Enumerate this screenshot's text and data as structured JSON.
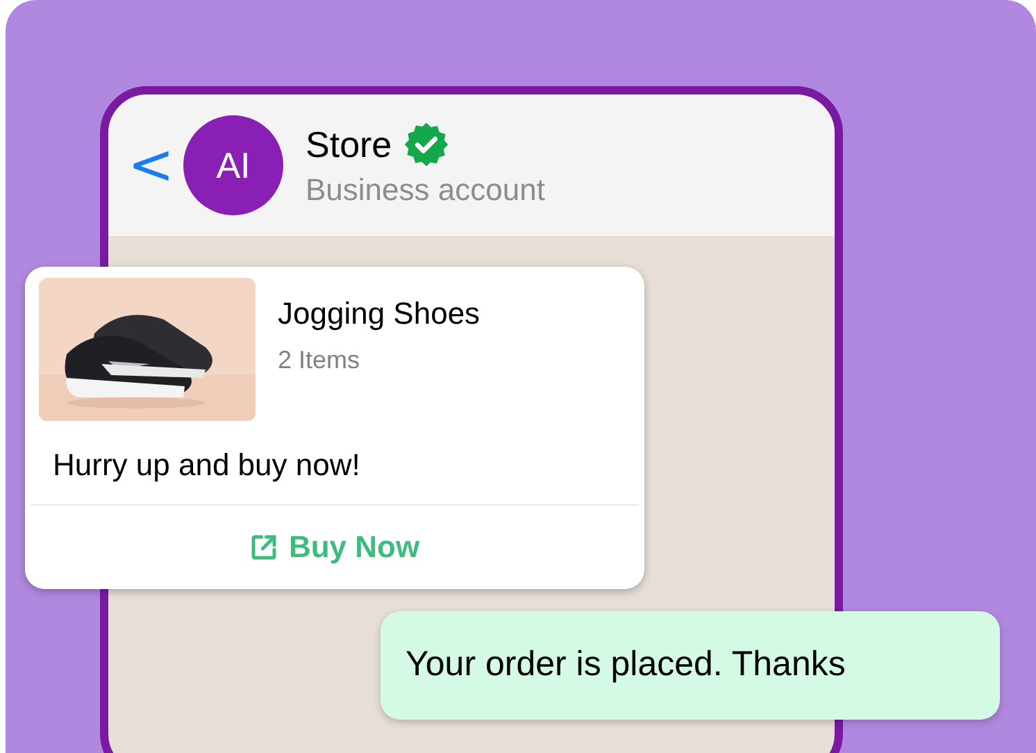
{
  "chat_header": {
    "back": "<",
    "avatar": "AI",
    "name": "Store",
    "verified": true,
    "subtitle": "Business account"
  },
  "messages": [
    {
      "kind": "product",
      "title": "Jogging Shoes",
      "count": "2 Items",
      "text": "Hurry up and buy now!",
      "action": "Buy Now"
    },
    {
      "kind": "outgoing",
      "text": "Your order is placed. Thanks"
    }
  ]
}
